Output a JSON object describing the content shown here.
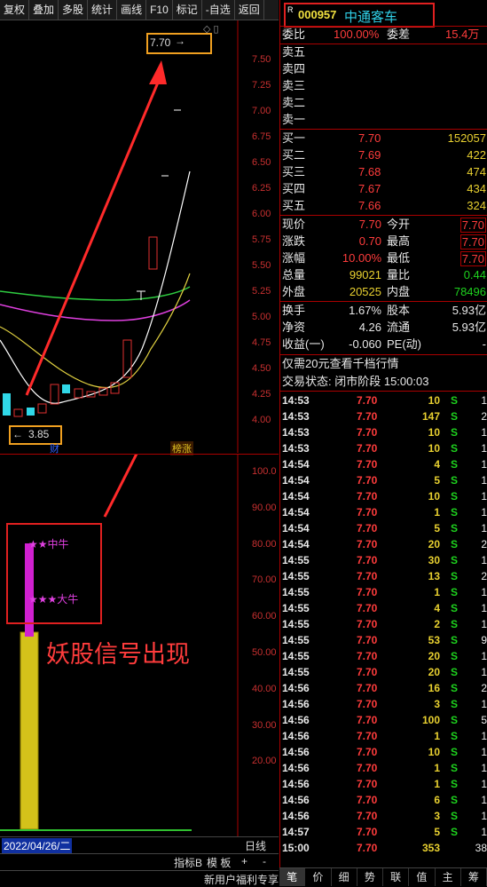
{
  "toolbar": [
    "复权",
    "叠加",
    "多股",
    "统计",
    "画线",
    "F10",
    "标记",
    "-自选",
    "返回"
  ],
  "kline": {
    "price_ticks": [
      "7.50",
      "7.25",
      "7.00",
      "6.75",
      "6.50",
      "6.25",
      "6.00",
      "5.75",
      "5.50",
      "5.25",
      "5.00",
      "4.75",
      "4.50",
      "4.25",
      "4.00"
    ],
    "high_label": "7.70",
    "low_label": "3.85",
    "cai": "财",
    "bang": "榜涨"
  },
  "indicator": {
    "ticks": [
      "100.0",
      "90.00",
      "80.00",
      "70.00",
      "60.00",
      "50.00",
      "40.00",
      "30.00",
      "20.00"
    ],
    "label_mid": "★★中牛",
    "label_big": "★★★大牛",
    "annotation": "妖股信号出现"
  },
  "statusbar": {
    "date": "2022/04/26/二",
    "period": "日线",
    "btn_index": "指标B",
    "btn_template": "模 板",
    "plus": "+",
    "minus": "-",
    "promo": "新用户福利专享"
  },
  "quote": {
    "code": "000957",
    "name": "中通客车",
    "badge": "R",
    "weibi_label": "委比",
    "weibi": "100.00%",
    "weicha_label": "委差",
    "weicha": "15.4万",
    "sell": [
      {
        "l": "卖五"
      },
      {
        "l": "卖四"
      },
      {
        "l": "卖三"
      },
      {
        "l": "卖二"
      },
      {
        "l": "卖一"
      }
    ],
    "buy": [
      {
        "l": "买一",
        "p": "7.70",
        "v": "152057"
      },
      {
        "l": "买二",
        "p": "7.69",
        "v": "422"
      },
      {
        "l": "买三",
        "p": "7.68",
        "v": "474"
      },
      {
        "l": "买四",
        "p": "7.67",
        "v": "434"
      },
      {
        "l": "买五",
        "p": "7.66",
        "v": "324"
      }
    ],
    "stats": [
      {
        "a": "现价",
        "av": "7.70",
        "b": "今开",
        "bv": "7.70"
      },
      {
        "a": "涨跌",
        "av": "0.70",
        "b": "最高",
        "bv": "7.70"
      },
      {
        "a": "涨幅",
        "av": "10.00%",
        "b": "最低",
        "bv": "7.70"
      },
      {
        "a": "总量",
        "av": "99021",
        "b": "量比",
        "bv": "0.44"
      },
      {
        "a": "外盘",
        "av": "20525",
        "b": "内盘",
        "bv": "78496"
      }
    ],
    "fin": [
      {
        "a": "换手",
        "av": "1.67%",
        "b": "股本",
        "bv": "5.93亿"
      },
      {
        "a": "净资",
        "av": "4.26",
        "b": "流通",
        "bv": "5.93亿"
      },
      {
        "a": "收益(一)",
        "av": "-0.060",
        "b": "PE(动)",
        "bv": "-"
      }
    ],
    "promo": "仅需20元查看千档行情",
    "trade_state": "交易状态: 闭市阶段 15:00:03"
  },
  "ticks": [
    {
      "t": "14:53",
      "p": "7.70",
      "v": "10",
      "s": "S",
      "n": "1"
    },
    {
      "t": "14:53",
      "p": "7.70",
      "v": "147",
      "s": "S",
      "n": "2"
    },
    {
      "t": "14:53",
      "p": "7.70",
      "v": "10",
      "s": "S",
      "n": "1"
    },
    {
      "t": "14:53",
      "p": "7.70",
      "v": "10",
      "s": "S",
      "n": "1"
    },
    {
      "t": "14:54",
      "p": "7.70",
      "v": "4",
      "s": "S",
      "n": "1"
    },
    {
      "t": "14:54",
      "p": "7.70",
      "v": "5",
      "s": "S",
      "n": "1"
    },
    {
      "t": "14:54",
      "p": "7.70",
      "v": "10",
      "s": "S",
      "n": "1"
    },
    {
      "t": "14:54",
      "p": "7.70",
      "v": "1",
      "s": "S",
      "n": "1"
    },
    {
      "t": "14:54",
      "p": "7.70",
      "v": "5",
      "s": "S",
      "n": "1"
    },
    {
      "t": "14:54",
      "p": "7.70",
      "v": "20",
      "s": "S",
      "n": "2"
    },
    {
      "t": "14:55",
      "p": "7.70",
      "v": "30",
      "s": "S",
      "n": "1"
    },
    {
      "t": "14:55",
      "p": "7.70",
      "v": "13",
      "s": "S",
      "n": "2"
    },
    {
      "t": "14:55",
      "p": "7.70",
      "v": "1",
      "s": "S",
      "n": "1"
    },
    {
      "t": "14:55",
      "p": "7.70",
      "v": "4",
      "s": "S",
      "n": "1"
    },
    {
      "t": "14:55",
      "p": "7.70",
      "v": "2",
      "s": "S",
      "n": "1"
    },
    {
      "t": "14:55",
      "p": "7.70",
      "v": "53",
      "s": "S",
      "n": "9"
    },
    {
      "t": "14:55",
      "p": "7.70",
      "v": "20",
      "s": "S",
      "n": "1"
    },
    {
      "t": "14:55",
      "p": "7.70",
      "v": "20",
      "s": "S",
      "n": "1"
    },
    {
      "t": "14:56",
      "p": "7.70",
      "v": "16",
      "s": "S",
      "n": "2"
    },
    {
      "t": "14:56",
      "p": "7.70",
      "v": "3",
      "s": "S",
      "n": "1"
    },
    {
      "t": "14:56",
      "p": "7.70",
      "v": "100",
      "s": "S",
      "n": "5"
    },
    {
      "t": "14:56",
      "p": "7.70",
      "v": "1",
      "s": "S",
      "n": "1"
    },
    {
      "t": "14:56",
      "p": "7.70",
      "v": "10",
      "s": "S",
      "n": "1"
    },
    {
      "t": "14:56",
      "p": "7.70",
      "v": "1",
      "s": "S",
      "n": "1"
    },
    {
      "t": "14:56",
      "p": "7.70",
      "v": "1",
      "s": "S",
      "n": "1"
    },
    {
      "t": "14:56",
      "p": "7.70",
      "v": "6",
      "s": "S",
      "n": "1"
    },
    {
      "t": "14:56",
      "p": "7.70",
      "v": "3",
      "s": "S",
      "n": "1"
    },
    {
      "t": "14:57",
      "p": "7.70",
      "v": "5",
      "s": "S",
      "n": "1"
    },
    {
      "t": "15:00",
      "p": "7.70",
      "v": "353",
      "s": "",
      "n": "38"
    }
  ],
  "bottom_tabs": [
    "笔",
    "价",
    "细",
    "势",
    "联",
    "值",
    "主",
    "筹"
  ]
}
